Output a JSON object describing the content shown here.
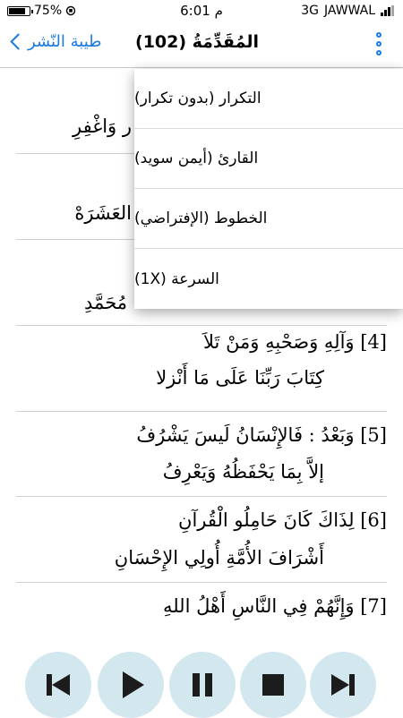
{
  "status_bar": {
    "battery_percent": "75%",
    "battery_level": 0.75,
    "time": "6:01 م",
    "network_type": "3G",
    "carrier": "JAWWAL"
  },
  "navbar": {
    "back_label": "طيبة النّشر",
    "title": "المُقَدِّمَةُ (102)",
    "more_icon": "vertical-dots-icon"
  },
  "verses": [
    {
      "line1": "",
      "line2": "ر وَاغْفِرِ"
    },
    {
      "line1": "",
      "line2": "العَشَرَهْ"
    },
    {
      "line1": "",
      "line2": "مُحَمَّدِ"
    },
    {
      "line1": "[4] وَآلِهِ وَصَحْبِهِ وَمَنْ تَلاَ",
      "line2": "كِتَابَ رَبِّنَا عَلَى مَا أَنْزلا"
    },
    {
      "line1": "[5] وَبَعْدُ : فَالإِنْسَانُ لَيسَ يَشْرُفُ",
      "line2": "إلاَّ بِمَا يَحْفَظُهُ وَيَعْرِفُ"
    },
    {
      "line1": "[6] لِذَاكَ كَانَ حَامِلُو الْقُرآنِ",
      "line2": "أَشْرَافَ الأُمَّةِ أُولِي الإِحْسَانِ"
    },
    {
      "line1": "[7] وَإِنَّهُمْ فِي النَّاسِ أَهْلُ اللهِ",
      "line2": ""
    }
  ],
  "menu": {
    "items": [
      {
        "label": "التكرار (بدون تكرار)"
      },
      {
        "label": "القارئ (أيمن سويد)"
      },
      {
        "label": "الخطوط (الإفتراضي)"
      },
      {
        "label": "السرعة (1X)"
      }
    ]
  },
  "controls": {
    "icons": [
      "skip-previous-icon",
      "play-icon",
      "pause-icon",
      "stop-icon",
      "skip-next-icon"
    ],
    "button_color": "#d3e7ef",
    "icon_color": "#1c1c1c"
  },
  "colors": {
    "accent": "#1a7ae0",
    "divider": "#d0d0d0"
  }
}
